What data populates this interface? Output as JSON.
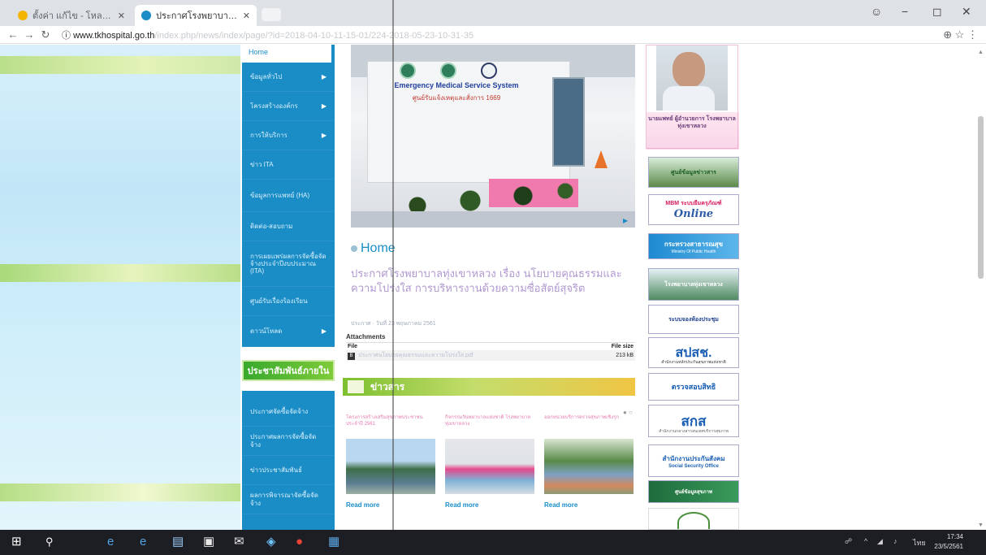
{
  "browser": {
    "tabs": [
      {
        "label": "ตั้งค่า แก้ไข - โหลดตารางงาน",
        "active": false,
        "icon": "tab-favicon-icon"
      },
      {
        "label": "ประกาศโรงพยาบาลทุ่งเขาหลวง",
        "active": true,
        "icon": "tab-favicon-icon"
      }
    ],
    "url_host": "www.tkhospital.go.th",
    "url_path": "/index.php/news/index/page/?id=2018-04-10-11-15-01/224-2018-05-23-10-31-35",
    "window_controls": [
      "−",
      "◻",
      "✕"
    ]
  },
  "menu": {
    "home_label": "Home",
    "items": [
      {
        "label": "ข้อมูลทั่วไป",
        "has_arrow": true
      },
      {
        "label": "โครงสร้างองค์กร",
        "has_arrow": true
      },
      {
        "label": "การให้บริการ",
        "has_arrow": true
      },
      {
        "label": "ข่าว ITA",
        "has_arrow": false
      },
      {
        "label": "ข้อมูลการแพทย์ (HA)",
        "has_arrow": false
      },
      {
        "label": "ติดต่อ-สอบถาม",
        "has_arrow": false
      },
      {
        "label": "การเผยแพร่ผลการจัดซื้อจัดจ้างประจำปีงบประมาณ (ITA)",
        "has_arrow": false
      },
      {
        "label": "ศูนย์รับเรื่องร้องเรียน",
        "has_arrow": false
      },
      {
        "label": "ดาวน์โหลด",
        "has_arrow": true
      }
    ],
    "green_banner": "ประชาสัมพันธ์ภายใน",
    "items2": [
      {
        "label": "ประกาศจัดซื้อจัดจ้าง"
      },
      {
        "label": "ประกาศผลการจัดซื้อจัดจ้าง"
      },
      {
        "label": "ข่าวประชาสัมพันธ์"
      },
      {
        "label": "ผลการพิจารณาจัดซื้อจัดจ้าง"
      }
    ]
  },
  "hero": {
    "sign_line1": "Emergency Medical Service System",
    "sign_line2": "ศูนย์รับแจ้งเหตุและสั่งการ 1669"
  },
  "article": {
    "section": "Home",
    "title": "ประกาศโรงพยาบาลทุ่งเขาหลวง เรื่อง นโยบายคุณธรรมและความโปร่งใส การบริหารงานด้วยความซื่อสัตย์สุจริต",
    "meta": "ประกาศ · วันที่ 23 พฤษภาคม 2561",
    "attachments_label": "Attachments",
    "col_file": "File",
    "col_size": "File size",
    "file_name": "ประกาศนโยบายคุณธรรมและความโปร่งใส.pdf",
    "file_size": "213 kB"
  },
  "news": {
    "section_title": "ข่าวสาร",
    "cards": [
      {
        "caption": "โครงการสร้างเสริมสุขภาพประชาชน ประจำปี 2561",
        "more": "Read more"
      },
      {
        "caption": "กิจกรรมวันพยาบาลแห่งชาติ โรงพยาบาลทุ่งเขาหลวง",
        "more": "Read more"
      },
      {
        "caption": "ออกหน่วยบริการตรวจสุขภาพเชิงรุก",
        "more": "Read more"
      }
    ]
  },
  "sidebar_right": {
    "director_name": "นายแพทย์ ผู้อำนวยการ โรงพยาบาลทุ่งเขาหลวง",
    "ads": [
      {
        "text": "ศูนย์ข้อมูลข่าวสาร"
      },
      {
        "text": "MBM ระบบยืมครุภัณฑ์",
        "sub": "Online"
      },
      {
        "text": "กระทรวงสาธารณสุข",
        "sub": "Ministry Of Public Health"
      },
      {
        "text": "โรงพยาบาลทุ่งเขาหลวง"
      },
      {
        "text": "ระบบจองห้องประชุม"
      },
      {
        "text": "สปสช.",
        "sub": "สำนักงานหลักประกันสุขภาพแห่งชาติ"
      },
      {
        "text": "ตรวจสอบสิทธิ"
      },
      {
        "text": "สกส",
        "sub": "สำนักงานกลางสารสนเทศบริการสุขภาพ"
      },
      {
        "text": "สำนักงานประกันสังคม",
        "sub": "Social Security Office"
      },
      {
        "text": "ศูนย์ข้อมูลสุขภาพ"
      }
    ]
  },
  "taskbar": {
    "lang": "ไทย",
    "time": "17:34",
    "date": "23/5/2561"
  }
}
